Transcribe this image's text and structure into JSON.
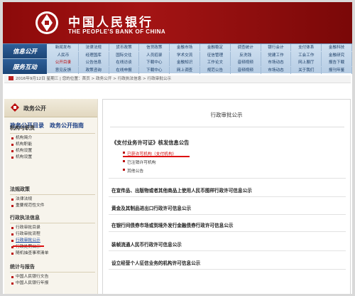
{
  "header": {
    "name_cn": "中国人民银行",
    "name_en": "THE PEOPLE'S BANK OF CHINA"
  },
  "nav": {
    "side": [
      "信息公开",
      "服务互动"
    ],
    "rows": [
      [
        "新闻发布",
        "法律法规",
        "货币政策",
        "信贷政策",
        "金融市场",
        "金融稳定",
        "调查统计",
        "银行会计",
        "支付体系",
        "金融科技"
      ],
      [
        "人民币",
        "经理国库",
        "国际交往",
        "人员招录",
        "学术交流",
        "征信管理",
        "反洗钱",
        "党建工作",
        "工会工作",
        "金融研究"
      ],
      [
        "公开目录",
        "公告信息",
        "在线访谈",
        "下载中心",
        "金融知识",
        "工作论文",
        "音频视频",
        "市场动态",
        "网上展厅",
        "报告下载"
      ],
      [
        "意见反馈",
        "政策咨询",
        "在线申报",
        "下载中心",
        "网上调查",
        "规范公告",
        "音频视频",
        "市场动态",
        "关于我们",
        "报刊年鉴"
      ]
    ]
  },
  "breadcrumb": "2016年9月12日 星期三 | 您的位置：首页 > 政务公开 > 行政执法信息 > 行政审批公示",
  "left": {
    "header": "政务公开",
    "links": [
      "政务公开目录",
      "政务公开指南"
    ],
    "sections": [
      {
        "title": "机构与职责",
        "items": [
          "机构简介",
          "机构职能",
          "机构设置",
          "机构设置"
        ]
      },
      {
        "title": "法规政策",
        "items": [
          "法律法规",
          "重要规范性文件"
        ]
      },
      {
        "title": "行政执法信息",
        "items": [
          "行政审批目录",
          "行政审批流程",
          "行政审批公示",
          "行政处罚公示",
          "随机抽查事项清单"
        ]
      },
      {
        "title": "统计与报告",
        "items": [
          "中国人民银行文告",
          "中国人民银行年报"
        ]
      }
    ]
  },
  "main": {
    "title": "行政审批公示",
    "group_title": "《支付业务许可证》核发信息公告",
    "subs": [
      "已获许可机构（支付机构）",
      "已注销许可机构",
      "其他公告"
    ],
    "items": [
      "在宣传品、出版物或者其他商品上使用人民币图样行政许可信息公示",
      "黄金及其制品进出口行政许可信息公示",
      "在银行间债券市场或到境外发行金融债券行政许可信息公示",
      "装帧流通人民币行政许可信息公示",
      "设立经营个人征信业务的机构许可信息公示"
    ]
  },
  "colors": {
    "brand_red": "#a41414",
    "nav_blue": "#1d4677",
    "highlight_red": "#d11"
  }
}
